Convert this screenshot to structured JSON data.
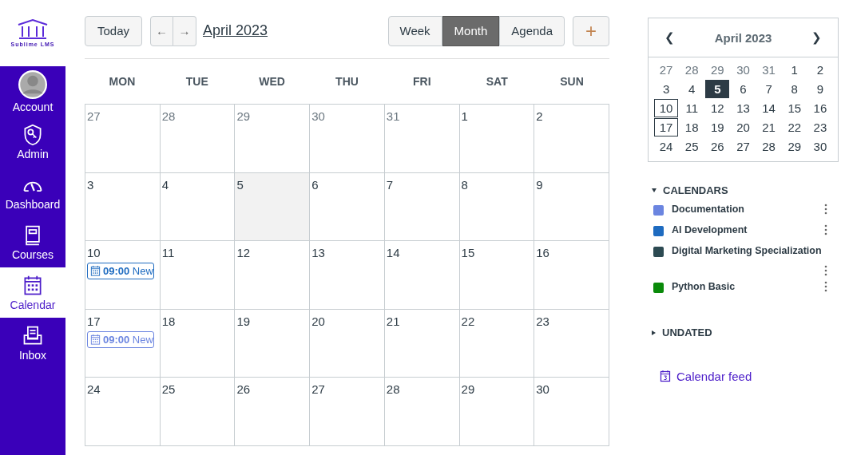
{
  "logo": {
    "text": "Sublime LMS"
  },
  "nav": [
    {
      "label": "Account",
      "kind": "avatar",
      "selected": false
    },
    {
      "label": "Admin",
      "kind": "shield",
      "selected": false
    },
    {
      "label": "Dashboard",
      "kind": "gauge",
      "selected": false
    },
    {
      "label": "Courses",
      "kind": "book",
      "selected": false
    },
    {
      "label": "Calendar",
      "kind": "calendar",
      "selected": true
    },
    {
      "label": "Inbox",
      "kind": "inbox",
      "selected": false
    }
  ],
  "toolbar": {
    "today": "Today",
    "prev": "←",
    "next": "→",
    "title": "April 2023",
    "views": [
      {
        "label": "Week",
        "selected": false
      },
      {
        "label": "Month",
        "selected": true
      },
      {
        "label": "Agenda",
        "selected": false
      }
    ],
    "add": "+"
  },
  "weekdays": [
    "MON",
    "TUE",
    "WED",
    "THU",
    "FRI",
    "SAT",
    "SUN"
  ],
  "weeks": [
    [
      {
        "day": "27",
        "other_month": true
      },
      {
        "day": "28",
        "other_month": true
      },
      {
        "day": "29",
        "other_month": true
      },
      {
        "day": "30",
        "other_month": true
      },
      {
        "day": "31",
        "other_month": true
      },
      {
        "day": "1"
      },
      {
        "day": "2"
      }
    ],
    [
      {
        "day": "3"
      },
      {
        "day": "4"
      },
      {
        "day": "5",
        "today": true
      },
      {
        "day": "6"
      },
      {
        "day": "7"
      },
      {
        "day": "8"
      },
      {
        "day": "9"
      }
    ],
    [
      {
        "day": "10",
        "events": [
          {
            "text": "**09:00** New",
            "color": "#1e6bc0"
          }
        ]
      },
      {
        "day": "11"
      },
      {
        "day": "12"
      },
      {
        "day": "13"
      },
      {
        "day": "14"
      },
      {
        "day": "15"
      },
      {
        "day": "16"
      }
    ],
    [
      {
        "day": "17",
        "events": [
          {
            "text": "**09:00** New",
            "color": "#6b85e0"
          }
        ]
      },
      {
        "day": "18"
      },
      {
        "day": "19"
      },
      {
        "day": "20"
      },
      {
        "day": "21"
      },
      {
        "day": "22"
      },
      {
        "day": "23"
      }
    ],
    [
      {
        "day": "24"
      },
      {
        "day": "25"
      },
      {
        "day": "26"
      },
      {
        "day": "27"
      },
      {
        "day": "28"
      },
      {
        "day": "29"
      },
      {
        "day": "30"
      }
    ]
  ],
  "mini": {
    "prev": "❮",
    "title": "April 2023",
    "next": "❯",
    "days": [
      {
        "day": "27",
        "other_month": true
      },
      {
        "day": "28",
        "other_month": true
      },
      {
        "day": "29",
        "other_month": true
      },
      {
        "day": "30",
        "other_month": true
      },
      {
        "day": "31",
        "other_month": true
      },
      {
        "day": "1"
      },
      {
        "day": "2"
      },
      {
        "day": "3"
      },
      {
        "day": "4"
      },
      {
        "day": "5",
        "selected": true
      },
      {
        "day": "6"
      },
      {
        "day": "7"
      },
      {
        "day": "8"
      },
      {
        "day": "9"
      },
      {
        "day": "10",
        "has_event": true
      },
      {
        "day": "11"
      },
      {
        "day": "12"
      },
      {
        "day": "13"
      },
      {
        "day": "14"
      },
      {
        "day": "15"
      },
      {
        "day": "16"
      },
      {
        "day": "17",
        "has_event": true
      },
      {
        "day": "18"
      },
      {
        "day": "19"
      },
      {
        "day": "20"
      },
      {
        "day": "21"
      },
      {
        "day": "22"
      },
      {
        "day": "23"
      },
      {
        "day": "24"
      },
      {
        "day": "25"
      },
      {
        "day": "26"
      },
      {
        "day": "27"
      },
      {
        "day": "28"
      },
      {
        "day": "29"
      },
      {
        "day": "30"
      }
    ]
  },
  "calendars": {
    "title": "CALENDARS",
    "expanded": true,
    "items": [
      {
        "name": "Documentation",
        "color": "#6b85e0"
      },
      {
        "name": "AI Development",
        "color": "#1e6bc0"
      },
      {
        "name": "Digital Marketing Specialization",
        "color": "#2c4a52"
      },
      {
        "name": "Python Basic",
        "color": "#0a8a0a"
      }
    ]
  },
  "undated": {
    "title": "UNDATED",
    "expanded": false
  },
  "feed": "Calendar feed"
}
